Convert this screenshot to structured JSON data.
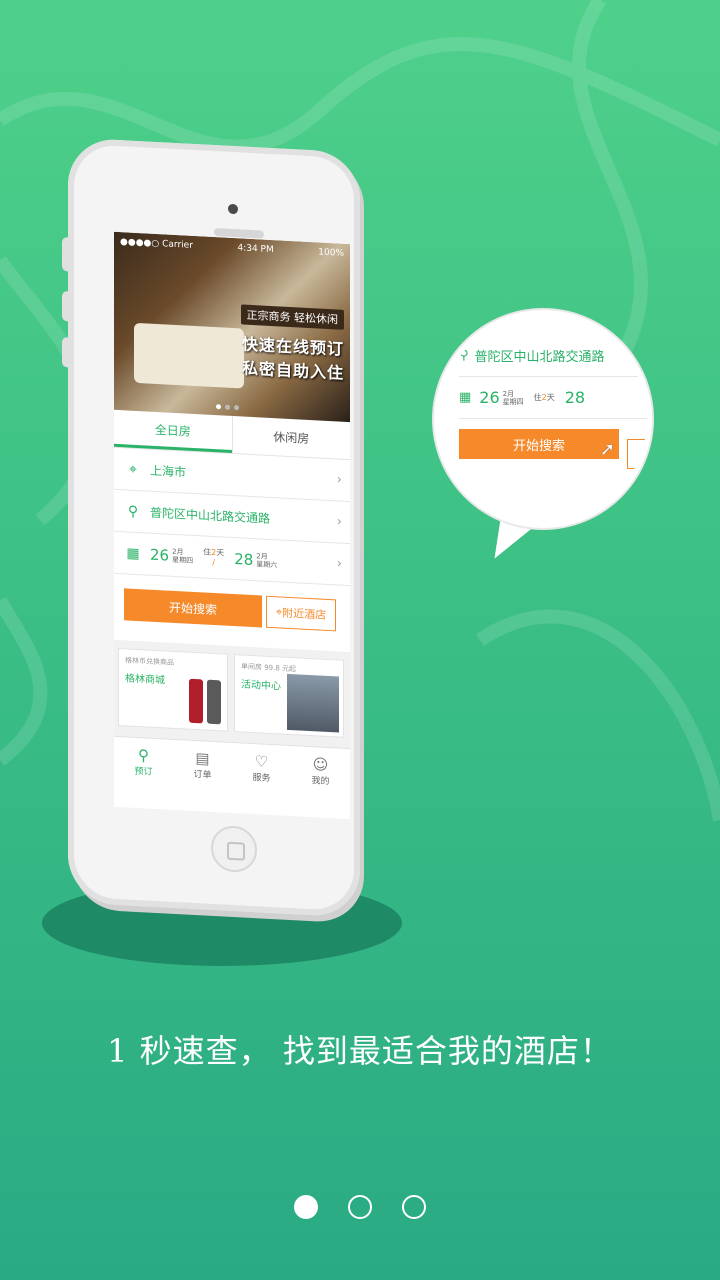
{
  "status_bar": {
    "carrier": "●●●●○ Carrier",
    "time": "4:34 PM",
    "battery": "100%"
  },
  "banner": {
    "tag": "正宗商务 轻松休闲",
    "line1": "快速在线预订",
    "line2": "私密自助入住"
  },
  "tabs": [
    {
      "label": "全日房",
      "active": true
    },
    {
      "label": "休闲房",
      "active": false
    }
  ],
  "city": "上海市",
  "address": "普陀区中山北路交通路",
  "dates": {
    "checkin_day": "26",
    "checkin_month": "2月",
    "checkin_weekday": "星期四",
    "stay_prefix": "住",
    "stay_nights": "2",
    "stay_unit": "天",
    "checkout_day": "28",
    "checkout_month": "2月",
    "checkout_weekday": "星期六"
  },
  "buttons": {
    "search": "开始搜索",
    "nearby": "附近酒店"
  },
  "promos": [
    {
      "small": "格林币兑换商品",
      "big": "格林商城"
    },
    {
      "small": "单间房 99.8 元起",
      "big": "活动中心"
    }
  ],
  "tabbar": [
    {
      "label": "预订",
      "icon": "search-icon",
      "glyph": "⚲",
      "active": true
    },
    {
      "label": "订单",
      "icon": "clipboard-icon",
      "glyph": "▤",
      "active": false
    },
    {
      "label": "服务",
      "icon": "heart-icon",
      "glyph": "♡",
      "active": false
    },
    {
      "label": "我的",
      "icon": "user-icon",
      "glyph": "☺",
      "active": false
    }
  ],
  "caption": "1 秒速查，  找到最适合我的酒店！",
  "colors": {
    "brand_green": "#2ab368",
    "accent_orange": "#f68a2b",
    "background": "#3cc085"
  },
  "pager": {
    "pages": 3,
    "current": 1
  }
}
